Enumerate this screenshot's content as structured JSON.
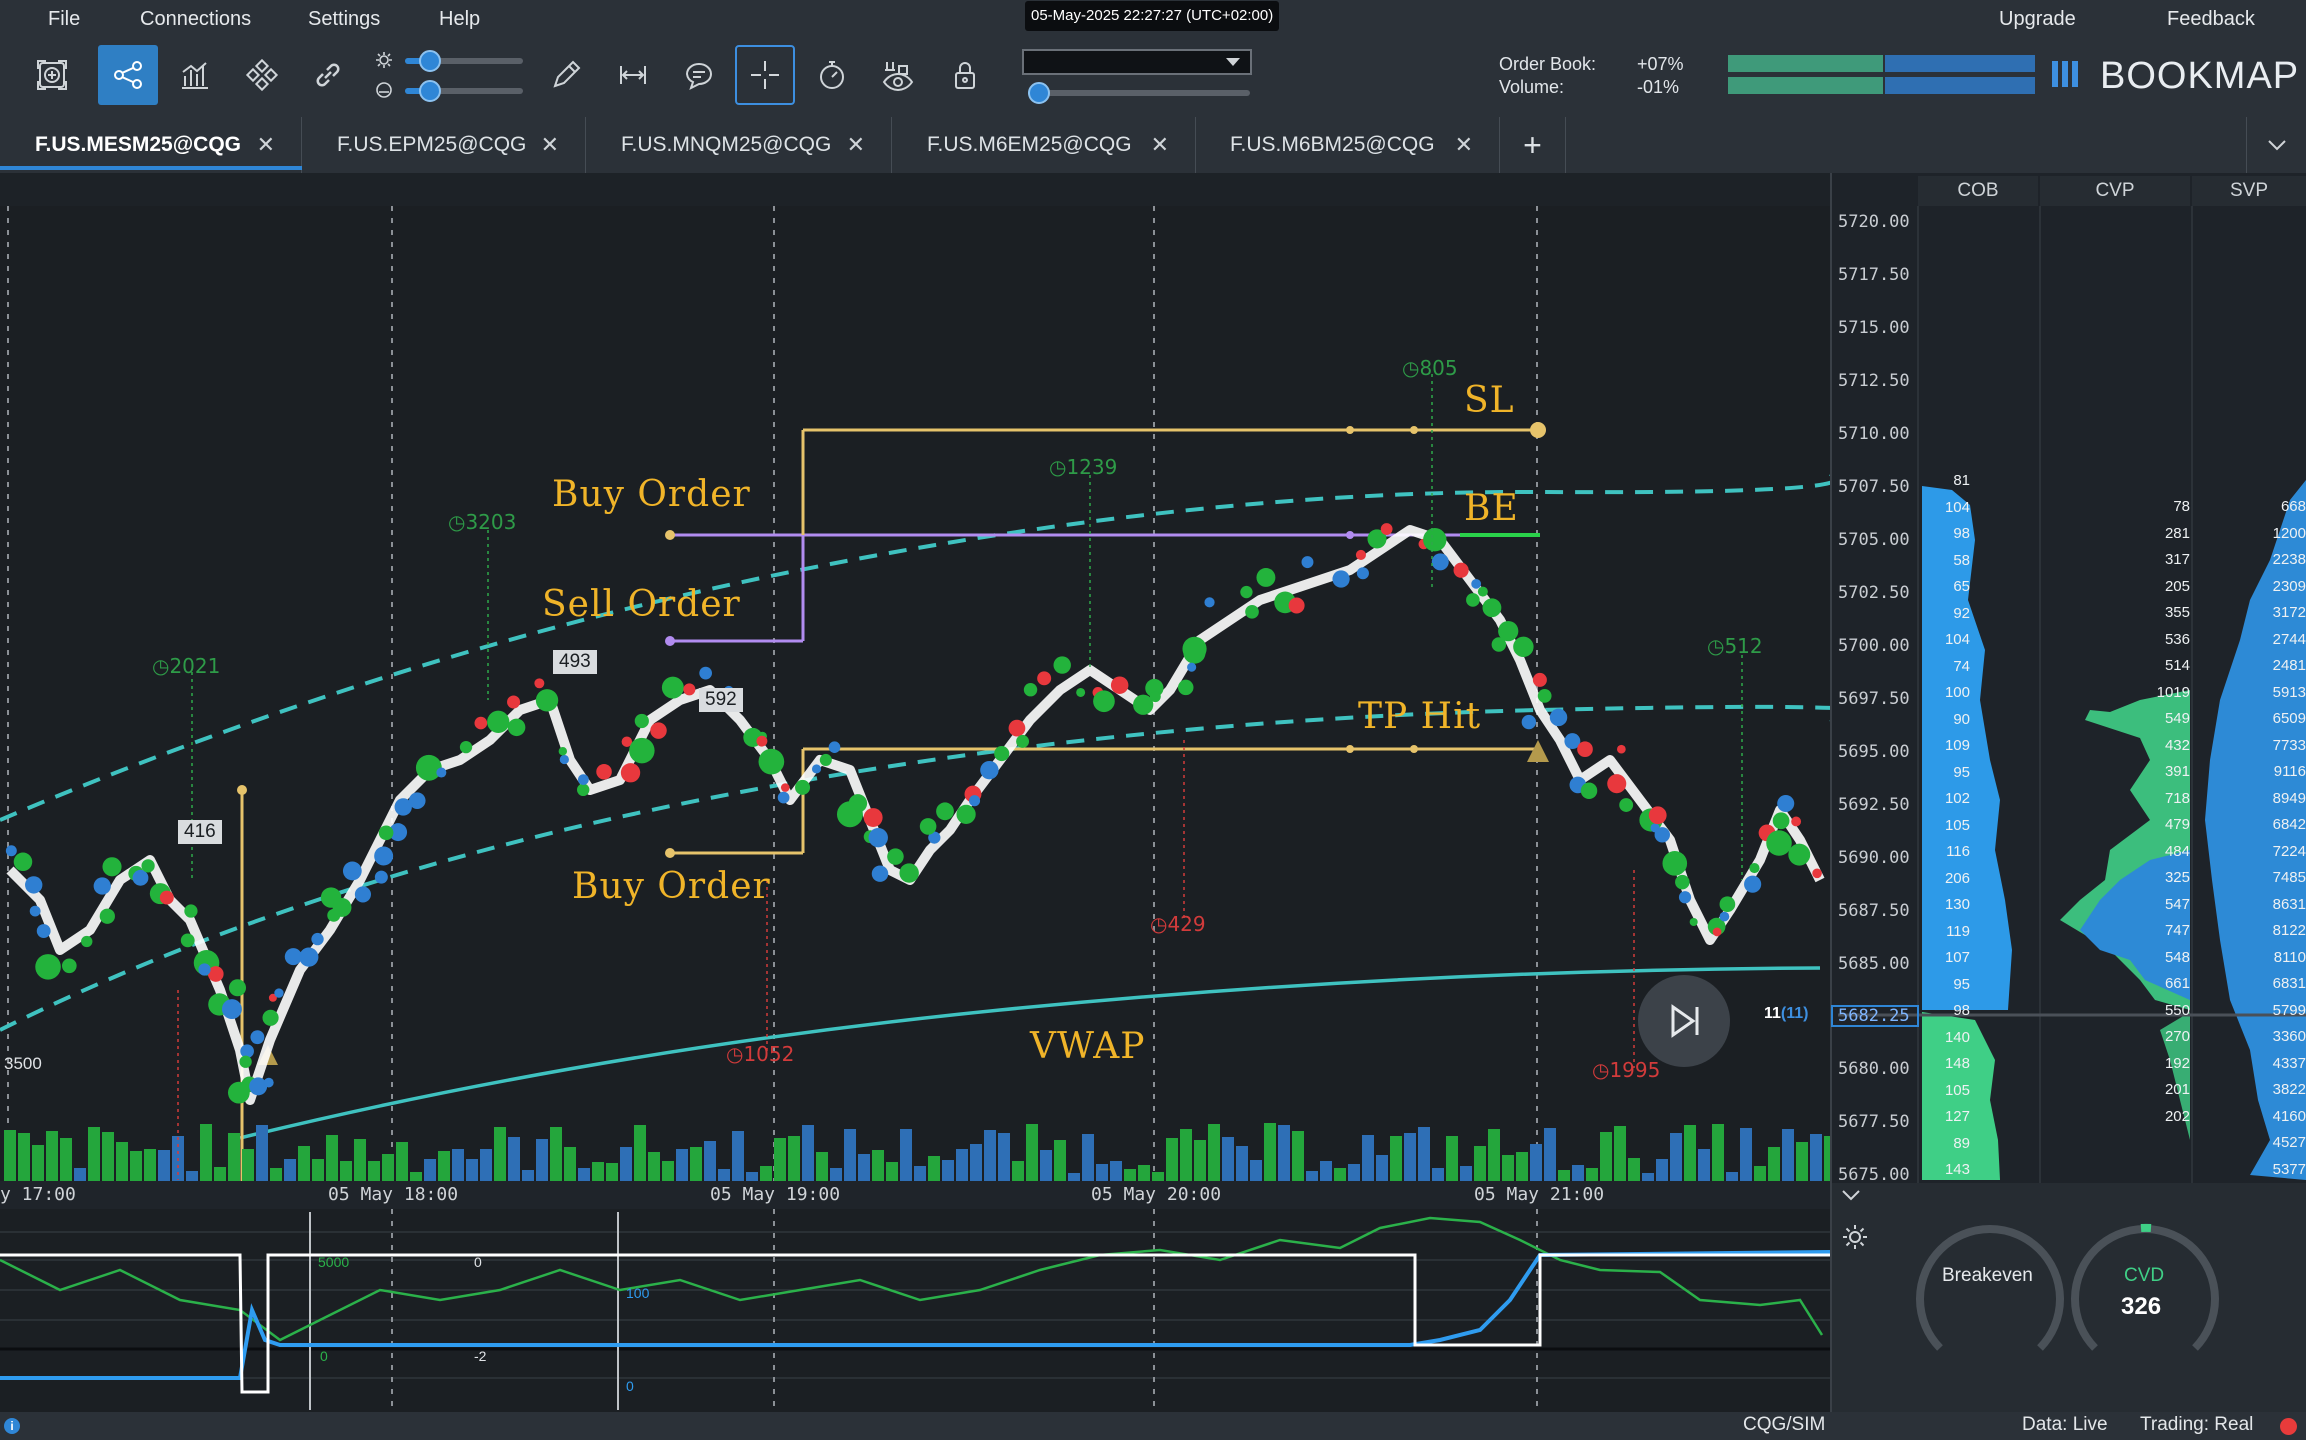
{
  "menu": {
    "file": "File",
    "connections": "Connections",
    "settings": "Settings",
    "help": "Help",
    "upgrade": "Upgrade",
    "feedback": "Feedback"
  },
  "clock": "05-May-2025 22:27:27 (UTC+02:00)",
  "toolbar": {
    "order_book_label": "Order Book:",
    "order_book_value": "+07%",
    "volume_label": "Volume:",
    "volume_value": "-01%",
    "logo": "BOOKMAP",
    "icons": [
      "add-chart-icon",
      "share-icon",
      "indicators-icon",
      "strategies-icon",
      "link-icon",
      "pencil-icon",
      "measure-icon",
      "comment-icon",
      "crosshair-icon",
      "timer-icon",
      "eye-settings-icon",
      "lock-icon"
    ]
  },
  "tabs": [
    "F.US.MESM25@CQG",
    "F.US.EPM25@CQG",
    "F.US.MNQM25@CQG",
    "F.US.M6EM25@CQG",
    "F.US.M6BM25@CQG"
  ],
  "side_headers": {
    "cob": "COB",
    "cvp": "CVP",
    "svp": "SVP"
  },
  "prices": [
    "5720.00",
    "5717.50",
    "5715.00",
    "5712.50",
    "5710.00",
    "5707.50",
    "5705.00",
    "5702.50",
    "5700.00",
    "5697.50",
    "5695.00",
    "5692.50",
    "5690.00",
    "5687.50",
    "5685.00",
    "5682.25",
    "5680.00",
    "5677.50",
    "5675.00"
  ],
  "cob_values": [
    "81",
    "104",
    "98",
    "58",
    "65",
    "92",
    "104",
    "74",
    "100",
    "90",
    "109",
    "95",
    "102",
    "105",
    "116",
    "206",
    "130",
    "119",
    "107",
    "95",
    "98",
    "140",
    "148",
    "105",
    "127",
    "89",
    "143"
  ],
  "cvp_values": [
    "78",
    "281",
    "317",
    "205",
    "355",
    "536",
    "514",
    "1019",
    "549",
    "432",
    "391",
    "718",
    "479",
    "484",
    "325",
    "547",
    "747",
    "548",
    "661",
    "550",
    "270",
    "192",
    "201",
    "202"
  ],
  "svp_values": [
    "668",
    "1200",
    "2238",
    "2309",
    "3172",
    "2744",
    "2481",
    "5913",
    "6509",
    "7733",
    "9116",
    "8949",
    "6842",
    "7224",
    "7485",
    "8631",
    "8122",
    "8110",
    "6831",
    "5799",
    "3360",
    "4337",
    "3822",
    "4160",
    "4527",
    "5377"
  ],
  "annotations": {
    "buy_order_1": "Buy Order",
    "sell_order": "Sell Order",
    "buy_order_2": "Buy Order",
    "sl": "SL",
    "be": "BE",
    "tp_hit": "TP Hit",
    "vwap": "VWAP"
  },
  "volume_dots": {
    "green": [
      "2021",
      "3203",
      "1239",
      "805",
      "512"
    ],
    "red": [
      "1052",
      "429",
      "1995"
    ]
  },
  "badges": [
    "416",
    "493",
    "592"
  ],
  "left_value": "3500",
  "current_price_marker": "11",
  "current_price_marker_paren": "(11)",
  "time_labels": [
    "y 17:00",
    "05 May 18:00",
    "05 May 19:00",
    "05 May 20:00",
    "05 May 21:00"
  ],
  "lower_pane_labels": {
    "a": "5000",
    "b": "0",
    "c": "0",
    "d": "-2",
    "e": "100",
    "f": "0"
  },
  "gauges": {
    "breakeven_label": "Breakeven",
    "cvd_label": "CVD",
    "cvd_value": "326"
  },
  "status": {
    "feed": "CQG/SIM",
    "data": "Data: Live",
    "trading": "Trading: Real"
  }
}
